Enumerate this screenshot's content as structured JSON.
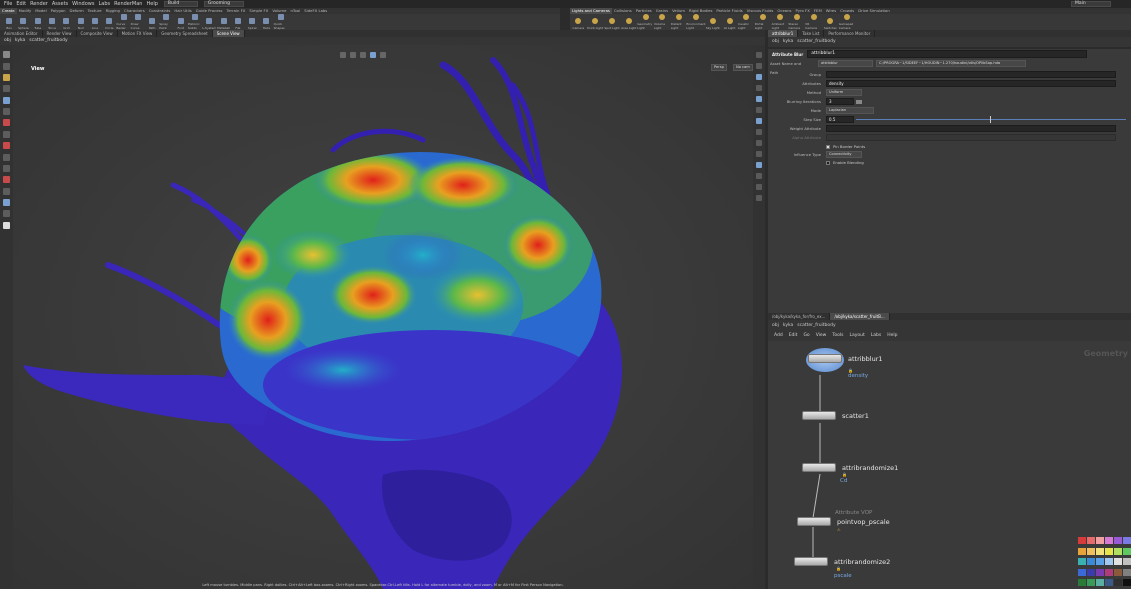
{
  "menubar": {
    "items": [
      "File",
      "Edit",
      "Render",
      "Assets",
      "Windows",
      "Labs",
      "RenderMan",
      "Help"
    ],
    "desktop": "Build",
    "desktop2": "Grooming",
    "main": "Main"
  },
  "shelf": {
    "tabs": [
      "Create",
      "Modify",
      "Model",
      "Polygon",
      "Deform",
      "Texture",
      "Rigging",
      "Characters",
      "Constraints",
      "Hair Utils",
      "Guide Process",
      "Terrain FX",
      "Simple FX",
      "Volume",
      "nTool",
      "SideFX Labs"
    ],
    "active_tab": "Create",
    "tools": [
      "Box",
      "Sphere",
      "Tube",
      "Torus",
      "Grid",
      "Null",
      "Line",
      "Circle",
      "Curve Bezier",
      "Draw Curve",
      "Path",
      "Spray Paint",
      "Font",
      "Platonic Solids",
      "L-System",
      "Metaball",
      "File",
      "Spiral",
      "Helix",
      "Quick Shapes"
    ]
  },
  "light_shelf": {
    "tabs": [
      "Lights and Cameras",
      "Collisions",
      "Particles",
      "Grains",
      "Vellum",
      "Rigid Bodies",
      "Particle Fluids",
      "Viscous Fluids",
      "Oceans",
      "Pyro FX",
      "FEM",
      "Wires",
      "Crowds",
      "Drive Simulation"
    ],
    "active_tab": "Lights and Cameras",
    "tools": [
      "Camera",
      "Point Light",
      "Spot Light",
      "Area Light",
      "Geometry Light",
      "Volume Light",
      "Distant Light",
      "Environment Light",
      "Sky Light",
      "GI Light",
      "Caustic Light",
      "Portal Light",
      "Ambient Light",
      "Stereo Camera",
      "VR Camera",
      "Switcher",
      "Gamepad Camera"
    ]
  },
  "viewer": {
    "tabs": [
      "Animation Editor",
      "Render View",
      "Composite View",
      "Motion FX View",
      "Geometry Spreadsheet",
      "Scene View"
    ],
    "active": "Scene View",
    "path": [
      "obj",
      "kyka",
      "scatter_fruitbody"
    ],
    "label": "View",
    "cam1": "Persp",
    "cam2": "No cam",
    "help": "Left mouse tumbles. Middle pans. Right dollies. Ctrl+Alt+Left box-zooms. Ctrl+Right zooms. Spacebar-Ctrl-Left tilts. Hold L for alternate tumble, dolly, and zoom. M or Alt+M for First Person Navigation."
  },
  "params": {
    "tabs": [
      "attribblur1",
      "Take List",
      "Performance Monitor"
    ],
    "path": [
      "obj",
      "kyka",
      "scatter_fruitbody"
    ],
    "node_type": "Attribute Blur",
    "node_name": "attribblur1",
    "asset_label": "Asset Name and Path",
    "asset_name": "attribblur",
    "asset_path": "C:/PROGRA~1/SIDEEF~1/HOUDIN~1.270/houdini/otls/OPlibSop.hda",
    "rows": [
      {
        "label": "Group",
        "value": "",
        "kind": "field"
      },
      {
        "label": "Attributes",
        "value": "density",
        "kind": "field"
      },
      {
        "label": "Method",
        "value": "Uniform",
        "kind": "menu"
      },
      {
        "label": "Blurring Iterations",
        "value": "3",
        "kind": "field"
      },
      {
        "label": "Mode",
        "value": "Laplacian",
        "kind": "menu"
      },
      {
        "label": "Step Size",
        "value": "0.5",
        "kind": "field"
      },
      {
        "label": "Weight Attribute",
        "value": "",
        "kind": "field"
      },
      {
        "label": "Alpha Attribute",
        "value": "",
        "kind": "field"
      },
      {
        "label": "",
        "value": "Pin Border Points",
        "kind": "check"
      },
      {
        "label": "Influence Type",
        "value": "Connectivity",
        "kind": "menu"
      },
      {
        "label": "",
        "value": "Enable Blending",
        "kind": "check"
      }
    ]
  },
  "network": {
    "tabs": [
      "/obj/kyka/kyka_for/fro_ex...",
      "/obj/kyka/scatter_fruitB..."
    ],
    "path": [
      "obj",
      "kyka",
      "scatter_fruitbody"
    ],
    "menu": [
      "Add",
      "Edit",
      "Go",
      "View",
      "Tools",
      "Layout",
      "Labs",
      "Help"
    ],
    "context": "Geometry",
    "nodes": [
      {
        "name": "attribblur1",
        "sub": "density"
      },
      {
        "name": "scatter1",
        "sub": ""
      },
      {
        "name": "attribrandomize1",
        "sub": "Cd"
      },
      {
        "name": "pointvop_pscale",
        "sub": "Attribute VOP"
      },
      {
        "name": "attribrandomize2",
        "sub": "pscale"
      }
    ]
  },
  "palette": [
    "#d63b3b",
    "#e86a6a",
    "#f0a0a0",
    "#d67ad6",
    "#9a5ad6",
    "#7a7ae6",
    "#e6a23b",
    "#f0c060",
    "#f2e07a",
    "#e6e64a",
    "#b0e060",
    "#60c860",
    "#3bb0b0",
    "#3b8ad6",
    "#5aa0e6",
    "#a0c8f0",
    "#e0e0e0",
    "#c0c0c0",
    "#3b6ad6",
    "#3b3bb0",
    "#7a3bb0",
    "#b03b7a",
    "#8a5a3a",
    "#808080",
    "#2a7a3a",
    "#3a9a5a",
    "#5ab0a0",
    "#3a5a8a",
    "#303030",
    "#101010"
  ]
}
